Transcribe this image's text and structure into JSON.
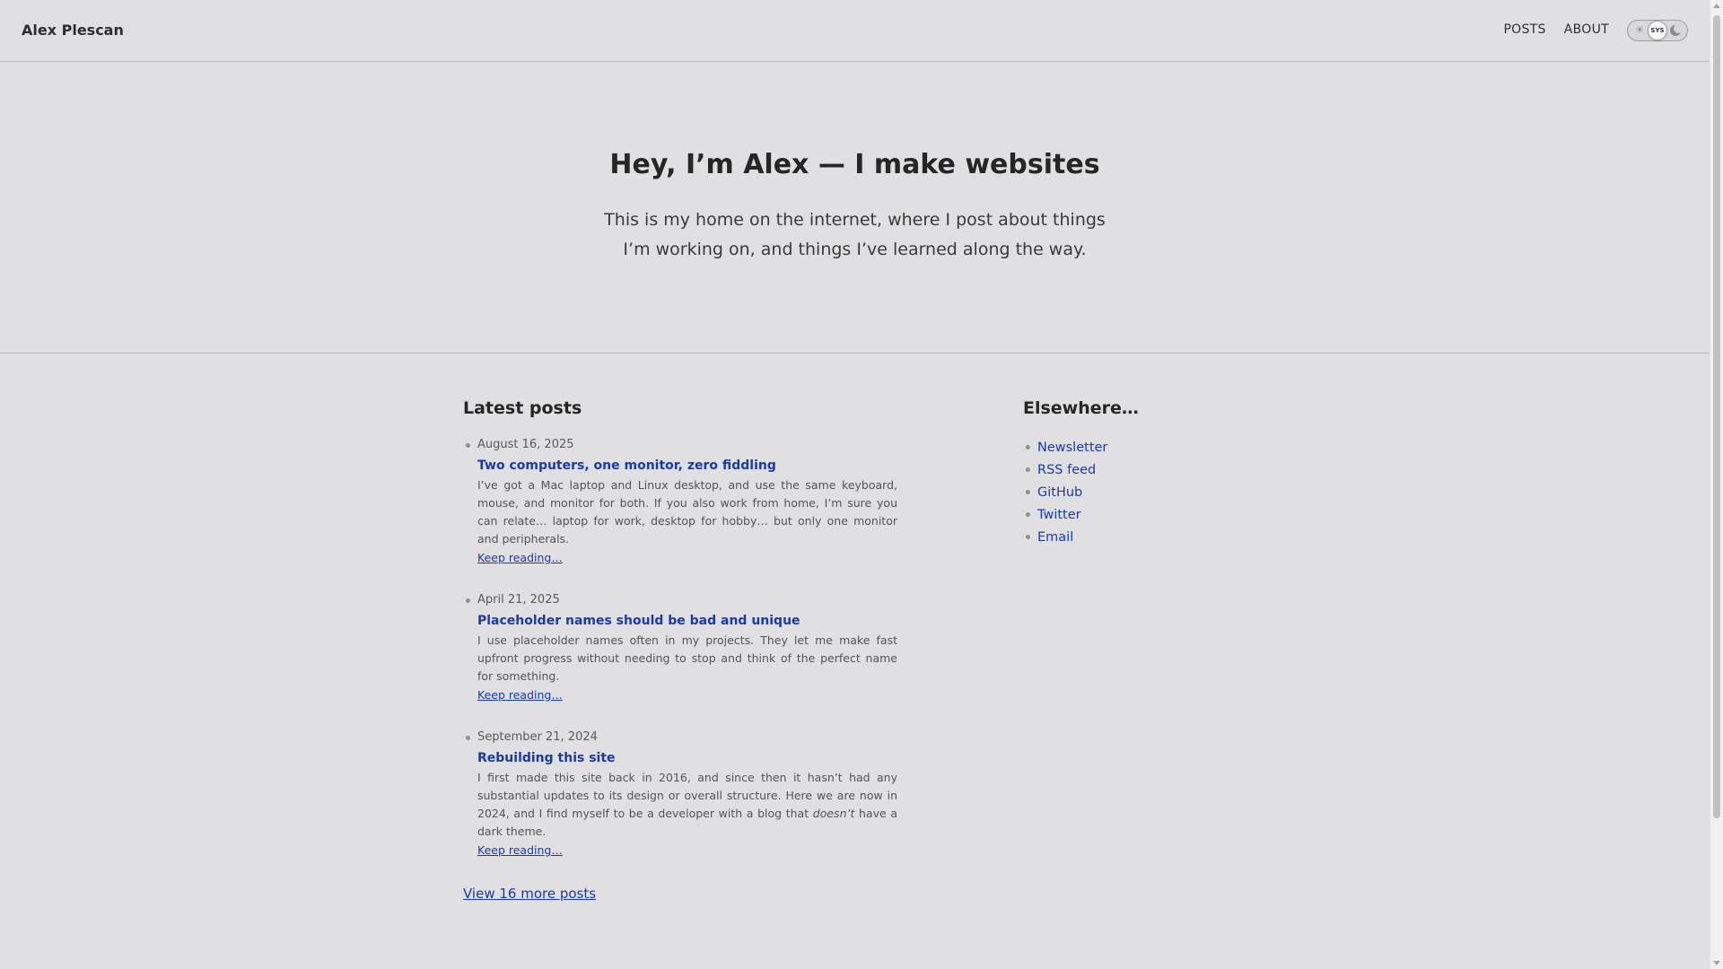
{
  "header": {
    "brand": "Alex Plescan",
    "nav": [
      {
        "label": "POSTS"
      },
      {
        "label": "ABOUT"
      }
    ],
    "theme_toggle": {
      "selected": "SYS",
      "options": [
        "sun-icon",
        "SYS",
        "moon-icon"
      ]
    }
  },
  "hero": {
    "title": "Hey, I’m Alex — I make websites",
    "subtitle": "This is my home on the internet, where I post about things I’m working on, and things I’ve learned along the way."
  },
  "latest_posts": {
    "heading": "Latest posts",
    "posts": [
      {
        "date": "August 16, 2025",
        "title": "Two computers, one monitor, zero fiddling",
        "excerpt": "I’ve got a Mac laptop and Linux desktop, and use the same keyboard, mouse, and monitor for both. If you also work from home, I’m sure you can relate… laptop for work, desktop for hobby… but only one monitor and peripherals.",
        "link": "Keep reading…"
      },
      {
        "date": "April 21, 2025",
        "title": "Placeholder names should be bad and unique",
        "excerpt": "I use placeholder names often in my projects. They let me make fast upfront progress without needing to stop and think of the perfect name for something.",
        "link": "Keep reading…"
      },
      {
        "date": "September 21, 2024",
        "title": "Rebuilding this site",
        "excerpt_before": "I first made this site back in 2016, and since then it hasn’t had any substantial updates to its design or overall structure. Here we are now in 2024, and I find myself to be a developer with a blog that ",
        "excerpt_emphasis": "doesn’t",
        "excerpt_after": " have a dark theme.",
        "link": "Keep reading…"
      }
    ],
    "view_more": "View 16 more posts"
  },
  "elsewhere": {
    "heading": "Elsewhere…",
    "links": [
      {
        "label": "Newsletter"
      },
      {
        "label": "RSS feed"
      },
      {
        "label": "GitHub"
      },
      {
        "label": "Twitter"
      },
      {
        "label": "Email"
      }
    ]
  },
  "colors": {
    "background": "#e0e0e3",
    "link": "#1a3aa8",
    "text": "#2a2a2a"
  }
}
